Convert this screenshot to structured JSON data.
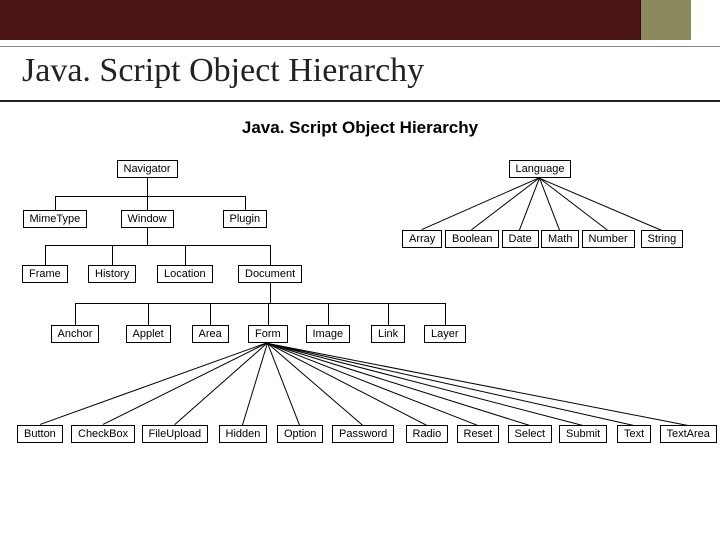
{
  "header": {
    "page_title": "Java. Script Object Hierarchy",
    "diagram_title": "Java. Script Object Hierarchy"
  },
  "nodes": {
    "navigator": "Navigator",
    "language": "Language",
    "mimetype": "MimeType",
    "window": "Window",
    "plugin": "Plugin",
    "array": "Array",
    "boolean": "Boolean",
    "date": "Date",
    "math": "Math",
    "number": "Number",
    "string": "String",
    "frame": "Frame",
    "history": "History",
    "location": "Location",
    "document": "Document",
    "anchor": "Anchor",
    "applet": "Applet",
    "area": "Area",
    "form": "Form",
    "image": "Image",
    "link": "Link",
    "layer": "Layer",
    "button": "Button",
    "checkbox": "CheckBox",
    "fileupload": "FileUpload",
    "hidden": "Hidden",
    "option": "Option",
    "password": "Password",
    "radio": "Radio",
    "reset": "Reset",
    "select": "Select",
    "submit": "Submit",
    "text": "Text",
    "textarea": "TextArea"
  }
}
